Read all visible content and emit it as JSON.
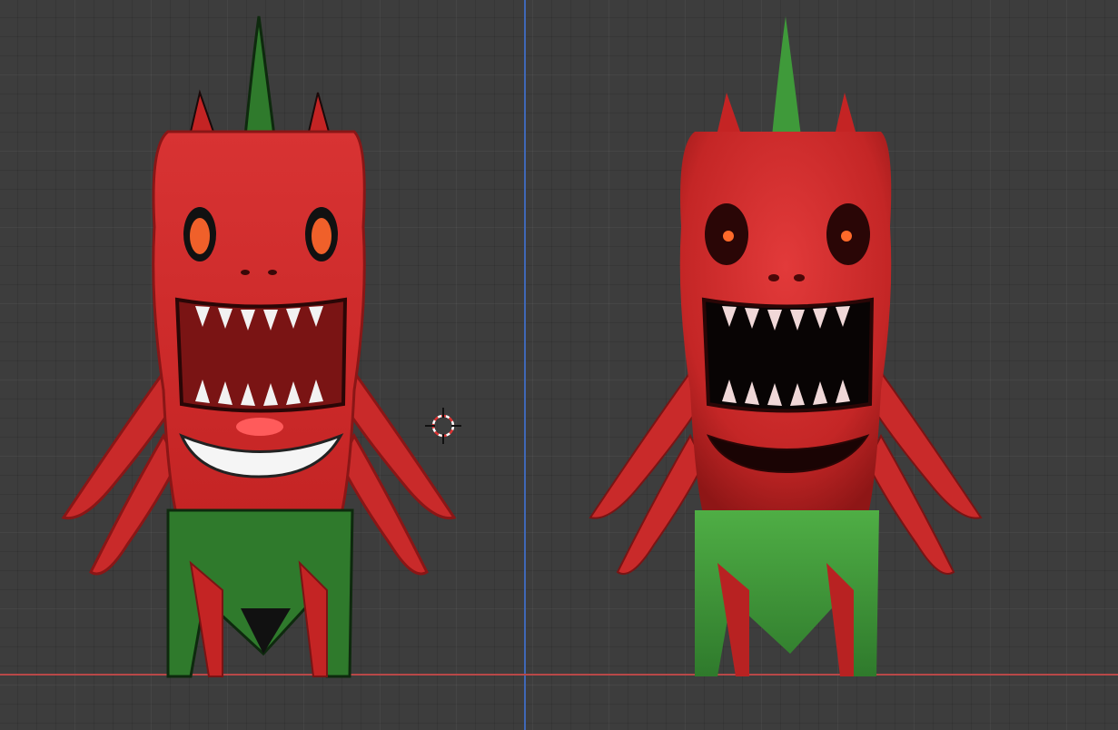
{
  "viewport": {
    "background": "#3d3d3d",
    "axis_y_color": "#3f68b7",
    "axis_x_color": "#b84848"
  },
  "icons": {
    "cursor": "3d-cursor-icon"
  },
  "models": [
    {
      "name": "red-pepper-creature-toon",
      "shading": "flat"
    },
    {
      "name": "red-pepper-creature-shaded",
      "shading": "smooth"
    }
  ],
  "colors": {
    "body_red": "#d42f2f",
    "body_dark": "#8e1616",
    "leaf_green": "#2f7a2c",
    "leaf_light": "#4fae45",
    "mouth_dark": "#7a1414",
    "eye_orange": "#f0602a",
    "teeth": "#f2f2f2"
  }
}
